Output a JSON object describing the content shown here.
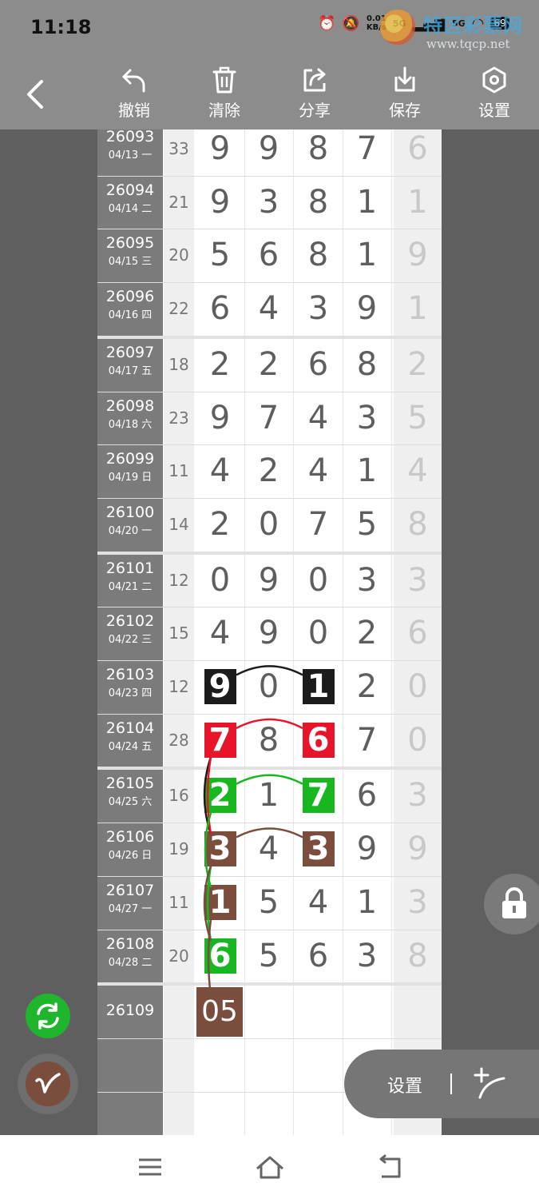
{
  "status": {
    "time": "11:18",
    "net_speed": "0.01",
    "net_unit": "KB/s",
    "signal1": "5G",
    "signal2": "5G",
    "battery": "69"
  },
  "watermark": {
    "title": "特区彩票网",
    "url": "www.tqcp.net"
  },
  "toolbar": {
    "undo": "撤销",
    "clear": "清除",
    "share": "分享",
    "save": "保存",
    "settings": "设置"
  },
  "colors": {
    "black": "#1b1b1b",
    "red": "#e8142a",
    "green": "#16b71f",
    "brown": "#7a4d3d"
  },
  "rows": [
    {
      "issue": "26093",
      "date": "04/13 一",
      "sum": "33",
      "digits": [
        "9",
        "9",
        "8",
        "7"
      ],
      "extra": "6"
    },
    {
      "issue": "26094",
      "date": "04/14 二",
      "sum": "21",
      "digits": [
        "9",
        "3",
        "8",
        "1"
      ],
      "extra": "1"
    },
    {
      "issue": "26095",
      "date": "04/15 三",
      "sum": "20",
      "digits": [
        "5",
        "6",
        "8",
        "1"
      ],
      "extra": "9"
    },
    {
      "issue": "26096",
      "date": "04/16 四",
      "sum": "22",
      "digits": [
        "6",
        "4",
        "3",
        "9"
      ],
      "extra": "1"
    },
    {
      "issue": "26097",
      "date": "04/17 五",
      "sum": "18",
      "digits": [
        "2",
        "2",
        "6",
        "8"
      ],
      "extra": "2"
    },
    {
      "issue": "26098",
      "date": "04/18 六",
      "sum": "23",
      "digits": [
        "9",
        "7",
        "4",
        "3"
      ],
      "extra": "5"
    },
    {
      "issue": "26099",
      "date": "04/19 日",
      "sum": "11",
      "digits": [
        "4",
        "2",
        "4",
        "1"
      ],
      "extra": "4"
    },
    {
      "issue": "26100",
      "date": "04/20 一",
      "sum": "14",
      "digits": [
        "2",
        "0",
        "7",
        "5"
      ],
      "extra": "8"
    },
    {
      "issue": "26101",
      "date": "04/21 二",
      "sum": "12",
      "digits": [
        "0",
        "9",
        "0",
        "3"
      ],
      "extra": "3"
    },
    {
      "issue": "26102",
      "date": "04/22 三",
      "sum": "15",
      "digits": [
        "4",
        "9",
        "0",
        "2"
      ],
      "extra": "6"
    },
    {
      "issue": "26103",
      "date": "04/23 四",
      "sum": "12",
      "digits": [
        "9",
        "0",
        "1",
        "2"
      ],
      "extra": "0"
    },
    {
      "issue": "26104",
      "date": "04/24 五",
      "sum": "28",
      "digits": [
        "7",
        "8",
        "6",
        "7"
      ],
      "extra": "0"
    },
    {
      "issue": "26105",
      "date": "04/25 六",
      "sum": "16",
      "digits": [
        "2",
        "1",
        "7",
        "6"
      ],
      "extra": "3"
    },
    {
      "issue": "26106",
      "date": "04/26 日",
      "sum": "19",
      "digits": [
        "3",
        "4",
        "3",
        "9"
      ],
      "extra": "9"
    },
    {
      "issue": "26107",
      "date": "04/27 一",
      "sum": "11",
      "digits": [
        "1",
        "5",
        "4",
        "1"
      ],
      "extra": "3"
    },
    {
      "issue": "26108",
      "date": "04/28 二",
      "sum": "20",
      "digits": [
        "6",
        "5",
        "6",
        "3"
      ],
      "extra": "8"
    },
    {
      "issue": "26109",
      "date": "",
      "sum": "",
      "digits": [
        "",
        "",
        "",
        ""
      ],
      "extra": ""
    }
  ],
  "highlights": [
    {
      "row": 10,
      "col": 0,
      "color": "black"
    },
    {
      "row": 10,
      "col": 2,
      "color": "black"
    },
    {
      "row": 11,
      "col": 0,
      "color": "red"
    },
    {
      "row": 11,
      "col": 2,
      "color": "red"
    },
    {
      "row": 12,
      "col": 0,
      "color": "green"
    },
    {
      "row": 12,
      "col": 2,
      "color": "green"
    },
    {
      "row": 13,
      "col": 0,
      "color": "brown"
    },
    {
      "row": 13,
      "col": 2,
      "color": "brown"
    },
    {
      "row": 14,
      "col": 0,
      "color": "brown"
    },
    {
      "row": 15,
      "col": 0,
      "color": "green"
    }
  ],
  "prediction": "05",
  "floating": {
    "settings_label": "设置"
  }
}
